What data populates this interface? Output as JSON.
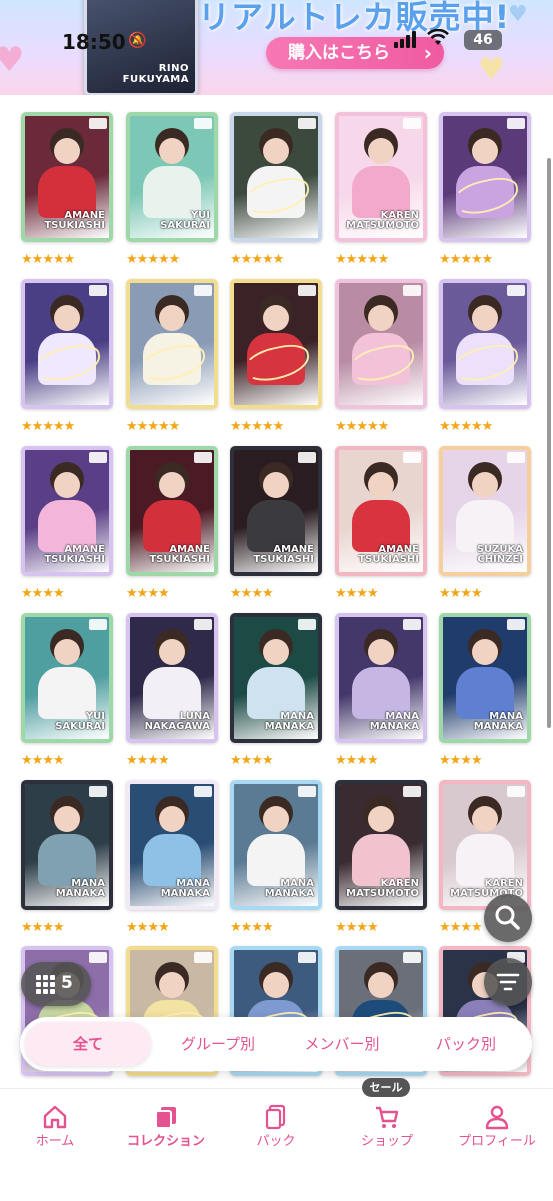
{
  "status_bar": {
    "time": "18:50",
    "battery": "46"
  },
  "banner": {
    "title": "リアルトレカ販売中!",
    "button_label": "購入はこちら",
    "card_name_first": "RINO",
    "card_name_last": "FUKUYAMA"
  },
  "colors": {
    "accent": "#e4528f",
    "star": "#f2a517",
    "fab": "#555555"
  },
  "cards": [
    {
      "name_first": "AMANE",
      "name_last": "TSUKIASHI",
      "frame": "#9fd8a8",
      "bg": "#6b2a3a",
      "dress": "#d3303c",
      "stars": 5
    },
    {
      "name_first": "YUI",
      "name_last": "SAKURAI",
      "frame": "#9fd8a8",
      "bg": "#7cc7b6",
      "dress": "#e8f3ee",
      "stars": 5
    },
    {
      "name_first": "",
      "name_last": "",
      "frame": "#c7d7e9",
      "bg": "#3c4a3e",
      "dress": "#f4f4f4",
      "stars": 5
    },
    {
      "name_first": "KAREN",
      "name_last": "MATSUMOTO",
      "frame": "#f3c2da",
      "bg": "#f6d8ea",
      "dress": "#f3a9c9",
      "stars": 5
    },
    {
      "name_first": "",
      "name_last": "",
      "frame": "#d6c3f0",
      "bg": "#5b3a7a",
      "dress": "#c9a4e0",
      "stars": 5
    },
    {
      "name_first": "",
      "name_last": "",
      "frame": "#d6c3f0",
      "bg": "#4a3f85",
      "dress": "#f0e8ff",
      "stars": 5
    },
    {
      "name_first": "",
      "name_last": "",
      "frame": "#f1dd8d",
      "bg": "#8a9bb6",
      "dress": "#f6f2e4",
      "stars": 5
    },
    {
      "name_first": "",
      "name_last": "",
      "frame": "#f1dd8d",
      "bg": "#3b2226",
      "dress": "#d6343e",
      "stars": 5
    },
    {
      "name_first": "",
      "name_last": "",
      "frame": "#efc3dc",
      "bg": "#b98ca4",
      "dress": "#f2c2d8",
      "stars": 5
    },
    {
      "name_first": "",
      "name_last": "",
      "frame": "#d6c3f0",
      "bg": "#6a5a9a",
      "dress": "#ece0fb",
      "stars": 5
    },
    {
      "name_first": "AMANE",
      "name_last": "TSUKIASHI",
      "frame": "#d6c3f0",
      "bg": "#5b3f86",
      "dress": "#f3b6da",
      "stars": 4
    },
    {
      "name_first": "AMANE",
      "name_last": "TSUKIASHI",
      "frame": "#9fd8a8",
      "bg": "#4b1a24",
      "dress": "#d2303b",
      "stars": 4
    },
    {
      "name_first": "AMANE",
      "name_last": "TSUKIASHI",
      "frame": "#2d2f3a",
      "bg": "#2a1d22",
      "dress": "#3b3b3f",
      "stars": 4
    },
    {
      "name_first": "AMANE",
      "name_last": "TSUKIASHI",
      "frame": "#f3b7c4",
      "bg": "#e9d5d0",
      "dress": "#d9333e",
      "stars": 4
    },
    {
      "name_first": "SUZUKA",
      "name_last": "CHINZEI",
      "frame": "#f6cf9f",
      "bg": "#e6d5e8",
      "dress": "#f7f2f5",
      "stars": 4
    },
    {
      "name_first": "YUI",
      "name_last": "SAKURAI",
      "frame": "#9fd8a8",
      "bg": "#4f9ea0",
      "dress": "#f4f4f4",
      "stars": 4
    },
    {
      "name_first": "LUNA",
      "name_last": "NAKAGAWA",
      "frame": "#d6c3f0",
      "bg": "#2f2a4a",
      "dress": "#f2f0f6",
      "stars": 4
    },
    {
      "name_first": "MANA",
      "name_last": "MANAKA",
      "frame": "#2d2f3a",
      "bg": "#1c4a45",
      "dress": "#cfe2ef",
      "stars": 4
    },
    {
      "name_first": "MANA",
      "name_last": "MANAKA",
      "frame": "#d6c3f0",
      "bg": "#44386b",
      "dress": "#c5b6e4",
      "stars": 4
    },
    {
      "name_first": "MANA",
      "name_last": "MANAKA",
      "frame": "#9fd8a8",
      "bg": "#203c6c",
      "dress": "#5f7fd1",
      "stars": 4
    },
    {
      "name_first": "MANA",
      "name_last": "MANAKA",
      "frame": "#2d2f3a",
      "bg": "#2d3e48",
      "dress": "#7fa1b2",
      "stars": 4
    },
    {
      "name_first": "MANA",
      "name_last": "MANAKA",
      "frame": "#f2e9f7",
      "bg": "#2a4d73",
      "dress": "#8fc1e6",
      "stars": 4
    },
    {
      "name_first": "MANA",
      "name_last": "MANAKA",
      "frame": "#a9d8f2",
      "bg": "#5b7a93",
      "dress": "#f4f4f4",
      "stars": 4
    },
    {
      "name_first": "KAREN",
      "name_last": "MATSUMOTO",
      "frame": "#2d2f3a",
      "bg": "#3a2b30",
      "dress": "#f0c3cf",
      "stars": 4
    },
    {
      "name_first": "KAREN",
      "name_last": "MATSUMOTO",
      "frame": "#f3b7c4",
      "bg": "#d8c9cf",
      "dress": "#f7f2f5",
      "stars": 4
    },
    {
      "name_first": "",
      "name_last": "",
      "frame": "#d6c3f0",
      "bg": "#8d6ea8",
      "dress": "#c8d8a2",
      "stars": 0
    },
    {
      "name_first": "",
      "name_last": "",
      "frame": "#f1dd8d",
      "bg": "#c9b9a4",
      "dress": "#f2e3a2",
      "stars": 0
    },
    {
      "name_first": "",
      "name_last": "",
      "frame": "#a9d8f2",
      "bg": "#3d5a7f",
      "dress": "#7e9ad0",
      "stars": 0
    },
    {
      "name_first": "",
      "name_last": "",
      "frame": "#a9d8f2",
      "bg": "#6a6f7a",
      "dress": "#1e4c7a",
      "stars": 0
    },
    {
      "name_first": "",
      "name_last": "",
      "frame": "#f3b7c4",
      "bg": "#2a3348",
      "dress": "#8a7fb9",
      "stars": 0
    }
  ],
  "fab": {
    "columns_count": "5"
  },
  "segments": [
    {
      "label": "全て",
      "active": true
    },
    {
      "label": "グループ別",
      "active": false
    },
    {
      "label": "メンバー別",
      "active": false
    },
    {
      "label": "パック別",
      "active": false
    }
  ],
  "sale_badge": "セール",
  "nav": [
    {
      "label": "ホーム",
      "icon": "home-icon",
      "active": false
    },
    {
      "label": "コレクション",
      "icon": "collection-icon",
      "active": true
    },
    {
      "label": "パック",
      "icon": "pack-icon",
      "active": false
    },
    {
      "label": "ショップ",
      "icon": "cart-icon",
      "active": false
    },
    {
      "label": "プロフィール",
      "icon": "profile-icon",
      "active": false
    }
  ]
}
